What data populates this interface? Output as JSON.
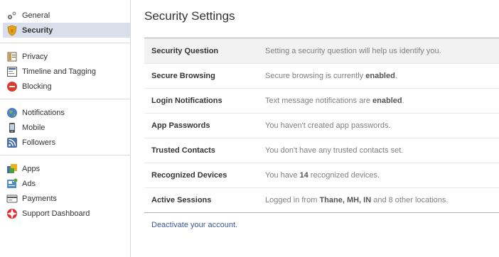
{
  "sidebar": {
    "groups": [
      [
        {
          "label": "General",
          "icon": "gear-icon"
        },
        {
          "label": "Security",
          "icon": "shield-icon",
          "active": true
        }
      ],
      [
        {
          "label": "Privacy",
          "icon": "lock-icon"
        },
        {
          "label": "Timeline and Tagging",
          "icon": "timeline-icon"
        },
        {
          "label": "Blocking",
          "icon": "block-icon"
        }
      ],
      [
        {
          "label": "Notifications",
          "icon": "globe-icon"
        },
        {
          "label": "Mobile",
          "icon": "phone-icon"
        },
        {
          "label": "Followers",
          "icon": "rss-icon"
        }
      ],
      [
        {
          "label": "Apps",
          "icon": "apps-icon"
        },
        {
          "label": "Ads",
          "icon": "ads-icon"
        },
        {
          "label": "Payments",
          "icon": "card-icon"
        },
        {
          "label": "Support Dashboard",
          "icon": "lifebuoy-icon"
        }
      ]
    ]
  },
  "main": {
    "title": "Security Settings",
    "rows": [
      {
        "name": "Security Question",
        "desc": [
          {
            "t": "Setting a security question will help us identify you."
          }
        ]
      },
      {
        "name": "Secure Browsing",
        "desc": [
          {
            "t": "Secure browsing is currently "
          },
          {
            "t": "enabled",
            "b": true
          },
          {
            "t": "."
          }
        ]
      },
      {
        "name": "Login Notifications",
        "desc": [
          {
            "t": "Text message notifications are "
          },
          {
            "t": "enabled",
            "b": true
          },
          {
            "t": "."
          }
        ]
      },
      {
        "name": "App Passwords",
        "desc": [
          {
            "t": "You haven't created app passwords."
          }
        ]
      },
      {
        "name": "Trusted Contacts",
        "desc": [
          {
            "t": "You don't have any trusted contacts set."
          }
        ]
      },
      {
        "name": "Recognized Devices",
        "desc": [
          {
            "t": "You have "
          },
          {
            "t": "14",
            "b": true
          },
          {
            "t": " recognized devices."
          }
        ]
      },
      {
        "name": "Active Sessions",
        "desc": [
          {
            "t": "Logged in from "
          },
          {
            "t": "Thane, MH, IN",
            "b": true
          },
          {
            "t": " and 8 other locations."
          }
        ]
      }
    ],
    "deactivate_label": "Deactivate your account."
  }
}
